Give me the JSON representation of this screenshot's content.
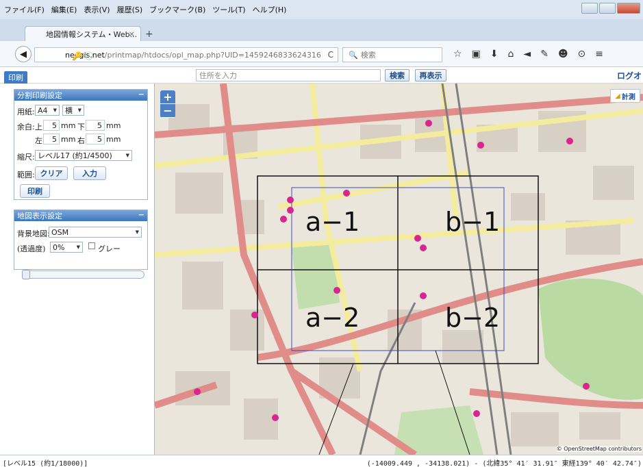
{
  "menubar": {
    "items": [
      "ファイル(F)",
      "編集(E)",
      "表示(V)",
      "履歴(S)",
      "ブックマーク(B)",
      "ツール(T)",
      "ヘルプ(H)"
    ]
  },
  "browser": {
    "tab_title": "地図情報システム・Web...",
    "tab_close": "×",
    "new_tab": "+",
    "url_domain": "neogis.net",
    "url_path": "/printmap/htdocs/opl_map.php?UID=1459246833624316",
    "search_placeholder": "検索"
  },
  "app": {
    "print_tab": "印刷",
    "address_placeholder": "住所を入力",
    "search_button": "検索",
    "redisplay_button": "再表示",
    "logout": "ログオ"
  },
  "split_print": {
    "header": "分割印刷設定",
    "paper_label": "用紙:",
    "paper_size": "A4",
    "orientation": "横",
    "margin_label": "余白:",
    "top_label": "上",
    "top_value": "5",
    "bottom_label": "下",
    "bottom_value": "5",
    "left_label": "左",
    "left_value": "5",
    "right_label": "右",
    "right_value": "5",
    "unit": "mm",
    "scale_label": "縮尺:",
    "scale_value": "レベル17 (約1/4500)",
    "range_label": "範囲:",
    "clear_button": "クリア",
    "input_button": "入力",
    "print_button": "印刷"
  },
  "map_display": {
    "header": "地図表示設定",
    "bg_label": "背景地図:",
    "bg_value": "OSM",
    "opacity_label": "(透過度)",
    "opacity_value": "0%",
    "gray_label": "グレー"
  },
  "map": {
    "zoom_in": "+",
    "zoom_out": "−",
    "measure": "計測",
    "cells": [
      "a−1",
      "b−1",
      "a−2",
      "b−2"
    ],
    "attribution": "© OpenStreetMap contributors",
    "colors": {
      "major_road": "#e28f8c",
      "secondary_road": "#f5f0a8",
      "park": "#b8dca2",
      "rail": "#8a8a8a",
      "grid_black": "#111111",
      "grid_blue": "#3b48c8"
    }
  },
  "status": {
    "scale": "[レベル15 (約1/18000)]",
    "coords": "(-14009.449 , -34138.021) - (北緯35° 41′ 31.91″ 東経139° 40′ 42.74″)"
  }
}
